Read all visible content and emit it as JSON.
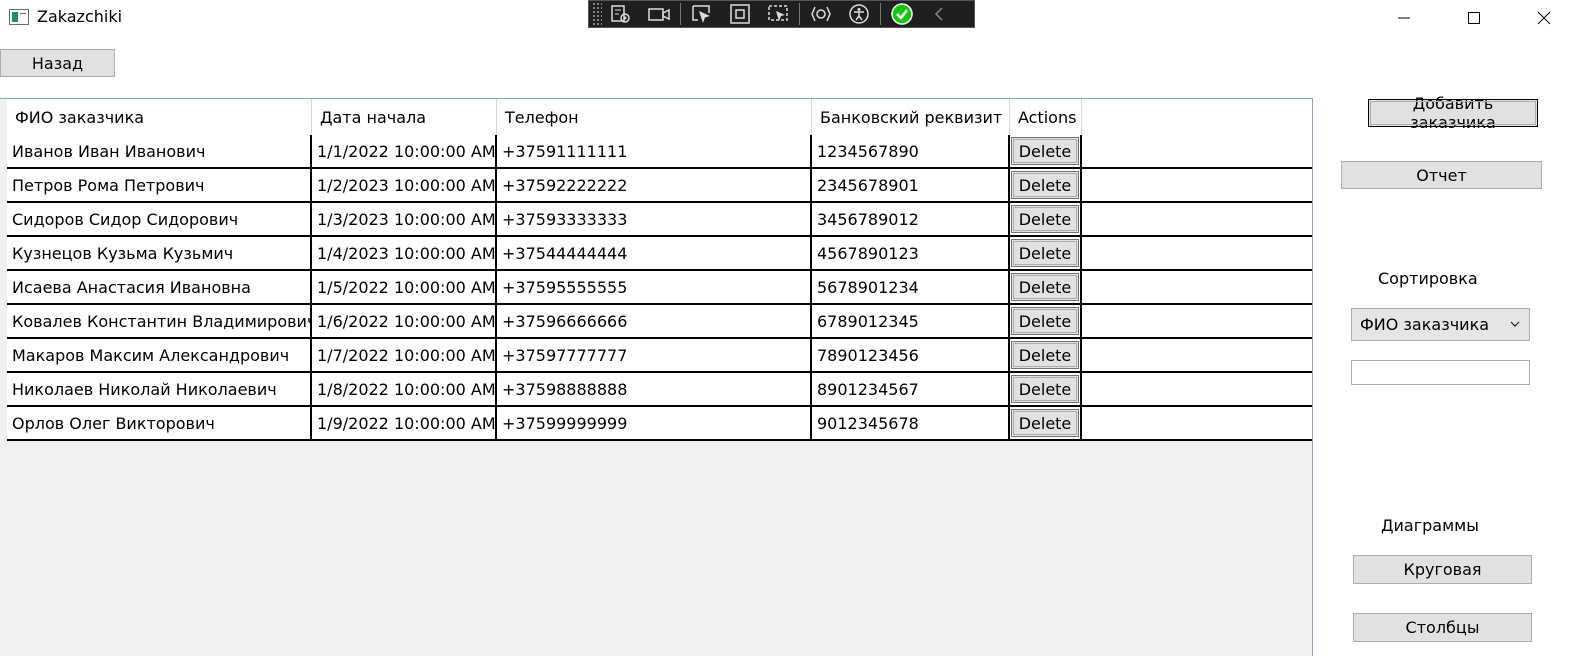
{
  "window": {
    "title": "Zakazchiki"
  },
  "toolbar": {
    "back_label": "Назад"
  },
  "grid": {
    "columns": [
      "ФИО заказчика",
      "Дата начала",
      "Телефон",
      "Банковский реквизит",
      "Actions"
    ],
    "delete_label": "Delete",
    "rows": [
      [
        "Иванов Иван Иванович",
        "1/1/2022 10:00:00 AM",
        "+37591111111",
        "1234567890"
      ],
      [
        "Петров Рома Петрович",
        "1/2/2023 10:00:00 AM",
        "+37592222222",
        "2345678901"
      ],
      [
        "Сидоров Сидор Сидорович",
        "1/3/2023 10:00:00 AM",
        "+37593333333",
        "3456789012"
      ],
      [
        "Кузнецов Кузьма Кузьмич",
        "1/4/2023 10:00:00 AM",
        "+37544444444",
        "4567890123"
      ],
      [
        "Исаева Анастасия Ивановна",
        "1/5/2022 10:00:00 AM",
        "+37595555555",
        "5678901234"
      ],
      [
        "Ковалев Константин Владимирович",
        "1/6/2022 10:00:00 AM",
        "+37596666666",
        "6789012345"
      ],
      [
        "Макаров Максим Александрович",
        "1/7/2022 10:00:00 AM",
        "+37597777777",
        "7890123456"
      ],
      [
        "Николаев Николай Николаевич",
        "1/8/2022 10:00:00 AM",
        "+37598888888",
        "8901234567"
      ],
      [
        "Орлов Олег Викторович",
        "1/9/2022 10:00:00 AM",
        "+37599999999",
        "9012345678"
      ]
    ]
  },
  "side": {
    "add_label": "Добавить заказчика",
    "report_label": "Отчет",
    "sort_label": "Сортировка",
    "sort_selected": "ФИО заказчика",
    "search_value": "",
    "charts_label": "Диаграммы",
    "pie_label": "Круговая",
    "bar_label": "Столбцы"
  },
  "icons": {
    "app": "app-window-icon",
    "minimize": "minimize-icon",
    "maximize": "maximize-icon",
    "close": "close-icon",
    "combo": "chevron-down-icon"
  },
  "colors": {
    "accent_check": "#16c60c",
    "grid_border": "#8fa4b8"
  }
}
